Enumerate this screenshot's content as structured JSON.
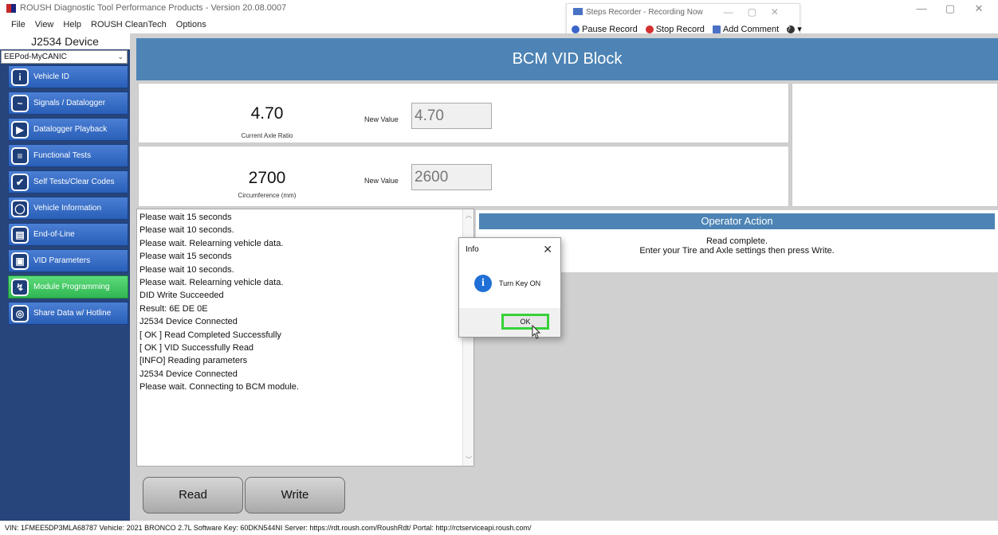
{
  "window": {
    "title": "ROUSH Diagnostic Tool Performance Products - Version 20.08.0007",
    "controls": [
      "—",
      "▢",
      "✕"
    ]
  },
  "menu": [
    "File",
    "View",
    "Help",
    "ROUSH CleanTech",
    "Options"
  ],
  "steps_recorder": {
    "title": "Steps Recorder - Recording Now",
    "pause": "Pause Record",
    "stop": "Stop Record",
    "comment": "Add Comment",
    "help": "?"
  },
  "sidebar": {
    "device_title": "J2534 Device",
    "device_selected": "EEPod-MyCANIC",
    "items": [
      {
        "label": "Vehicle ID",
        "icon": "i"
      },
      {
        "label": "Signals / Datalogger",
        "icon": "~"
      },
      {
        "label": "Datalogger Playback",
        "icon": "▶"
      },
      {
        "label": "Functional Tests",
        "icon": "≡"
      },
      {
        "label": "Self Tests/Clear Codes",
        "icon": "✔"
      },
      {
        "label": "Vehicle Information",
        "icon": "◯"
      },
      {
        "label": "End-of-Line",
        "icon": "▤"
      },
      {
        "label": "VID Parameters",
        "icon": "▣"
      },
      {
        "label": "Module Programming",
        "icon": "↯"
      },
      {
        "label": "Share Data w/ Hotline",
        "icon": "◎"
      }
    ],
    "active_index": 8
  },
  "main": {
    "header": "BCM VID Block",
    "axle": {
      "value": "4.70",
      "caption": "Current Axle Ratio",
      "new_label": "New Value",
      "new_value": "4.70"
    },
    "circ": {
      "value": "2700",
      "caption": "Circumference (mm)",
      "new_label": "New Value",
      "new_value": "2600"
    },
    "log": [
      "Please wait 15 seconds",
      "Please wait 10 seconds.",
      "Please wait. Relearning vehicle data.",
      "Please wait 15 seconds",
      "Please wait 10 seconds.",
      "Please wait. Relearning vehicle data.",
      "DID Write Succeeded",
      "Result: 6E DE 0E",
      "J2534 Device Connected",
      "[ OK ] Read Completed Successfully",
      "[ OK ] VID Successfully Read",
      "[INFO] Reading parameters",
      "J2534 Device Connected",
      "Please wait. Connecting to BCM module."
    ],
    "operator": {
      "header": "Operator Action",
      "line1": "Read complete.",
      "line2": "Enter your Tire and Axle settings then press Write."
    },
    "buttons": {
      "read": "Read",
      "write": "Write"
    }
  },
  "dialog": {
    "title": "Info",
    "close": "✕",
    "message": "Turn Key ON",
    "ok": "OK",
    "icon": "i"
  },
  "status_bar": "VIN: 1FMEE5DP3MLA68787  Vehicle: 2021 BRONCO 2.7L Software Key: 60DKN544NI  Server:  https://rdt.roush.com/RoushRdt/  Portal:  http://rctserviceapi.roush.com/",
  "colors": {
    "sidebar": "#27457a",
    "nav": "#2a5fb8",
    "nav_active": "#2fb652",
    "header": "#4d84b5",
    "ok_highlight": "#35d23a"
  }
}
